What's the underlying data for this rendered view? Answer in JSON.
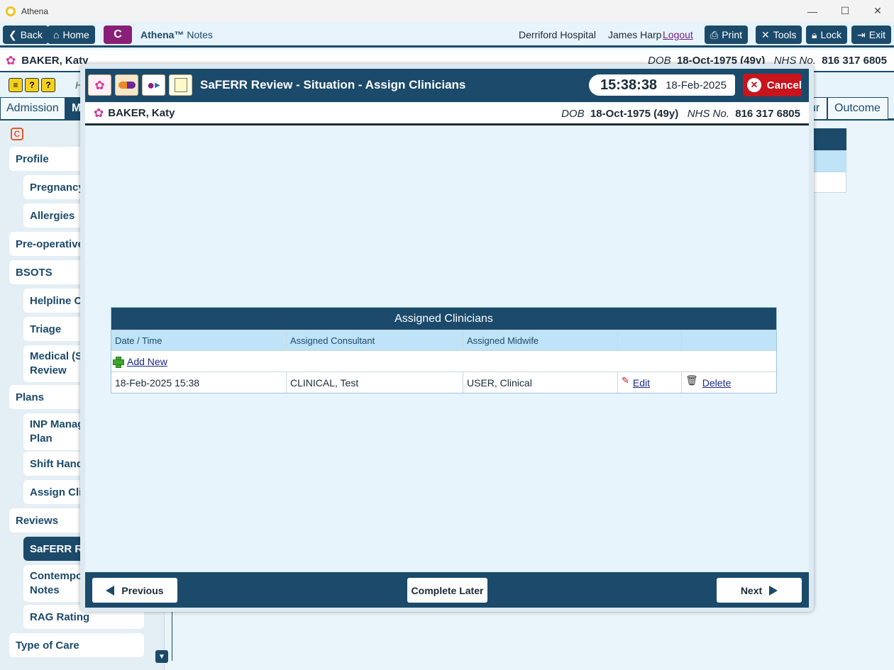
{
  "window": {
    "title": "Athena",
    "controls": [
      "—",
      "☐",
      "✕"
    ]
  },
  "topbar": {
    "back_label": "Back",
    "home_label": "Home",
    "c_label": "C",
    "brand_name": "Athena™",
    "brand_suffix": "Notes",
    "hospital": "Derriford Hospital",
    "user": "James Harp",
    "logout_label": "Logout",
    "print_label": "Print",
    "tools_label": "Tools",
    "lock_label": "Lock",
    "exit_label": "Exit"
  },
  "patient": {
    "name": "BAKER, Katy",
    "dob_label": "DOB",
    "dob_value": "18-Oct-1975 (49y)",
    "nhs_label": "NHS No.",
    "nhs_value": "816 317 6805"
  },
  "strip": {
    "h_label": "H"
  },
  "tabs": [
    {
      "label": "Admission"
    },
    {
      "label": "M"
    }
  ],
  "bg_tabs": [
    {
      "label": "ur"
    },
    {
      "label": "Outcome"
    }
  ],
  "sidebar": {
    "c_badge": "C",
    "items": [
      {
        "label": "Profile"
      },
      {
        "label": "Pregnancy"
      },
      {
        "label": "Allergies"
      },
      {
        "label": "Pre-operative"
      },
      {
        "label": "BSOTS"
      },
      {
        "label": "Helpline Co"
      },
      {
        "label": "Triage"
      },
      {
        "label": "Medical (Sa\nReview"
      },
      {
        "label": "Plans"
      },
      {
        "label": "INP Manag\nPlan"
      },
      {
        "label": "Shift Hando"
      },
      {
        "label": "Assign Clin"
      },
      {
        "label": "Reviews"
      },
      {
        "label": "SaFERR Rev"
      },
      {
        "label": "Contempor\nNotes"
      },
      {
        "label": "RAG Rating"
      },
      {
        "label": "Type of Care"
      }
    ]
  },
  "modal": {
    "title": "SaFERR Review - Situation - Assign Clinicians",
    "time": "15:38:38",
    "date": "18-Feb-2025",
    "cancel_label": "Cancel",
    "table": {
      "caption": "Assigned Clinicians",
      "headers": [
        "Date / Time",
        "Assigned Consultant",
        "Assigned Midwife",
        "",
        ""
      ],
      "add_new_label": "Add New",
      "rows": [
        {
          "datetime": "18-Feb-2025 15:38",
          "consultant": "CLINICAL, Test",
          "midwife": "USER, Clinical",
          "edit_label": "Edit",
          "delete_label": "Delete"
        }
      ]
    },
    "footer": {
      "previous_label": "Previous",
      "complete_later_label": "Complete Later",
      "next_label": "Next"
    }
  },
  "colors": {
    "primary": "#1b4a6b",
    "accent_purple": "#8a1f79",
    "cancel_red": "#c8141c",
    "header_light": "#bfe3f7"
  }
}
